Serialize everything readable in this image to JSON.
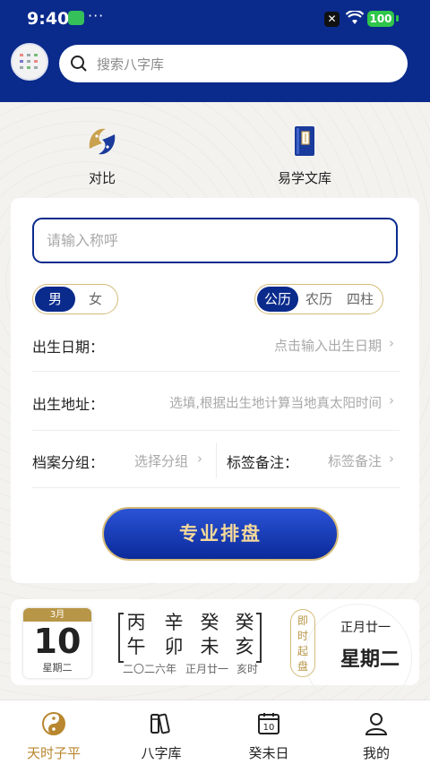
{
  "status": {
    "time": "9:40",
    "dots": "···",
    "battery": "100"
  },
  "header": {
    "search_placeholder": "搜索八字库"
  },
  "features": [
    {
      "label": "对比",
      "icon": "fish-taiji-icon"
    },
    {
      "label": "易学文库",
      "icon": "book-icon"
    }
  ],
  "form": {
    "name_placeholder": "请输入称呼",
    "gender": {
      "options": [
        "男",
        "女"
      ],
      "selected": "男"
    },
    "calendar": {
      "options": [
        "公历",
        "农历",
        "四柱"
      ],
      "selected": "公历"
    },
    "birth_date": {
      "label": "出生日期：",
      "value": "点击输入出生日期"
    },
    "birth_place": {
      "label": "出生地址：",
      "value": "选填,根据出生地计算当地真太阳时间"
    },
    "group": {
      "label": "档案分组：",
      "value": "选择分组"
    },
    "tags": {
      "label": "标签备注：",
      "value": "标签备注"
    },
    "submit_label": "专业排盘"
  },
  "calendar_card": {
    "month": "3月",
    "day": "10",
    "weekday_small": "星期二",
    "ganzhi": [
      {
        "top": "丙",
        "bottom": "午"
      },
      {
        "top": "辛",
        "bottom": "卯"
      },
      {
        "top": "癸",
        "bottom": "未"
      },
      {
        "top": "癸",
        "bottom": "亥"
      }
    ],
    "sub_year": "二〇二六年",
    "sub_lunar": "正月廿一",
    "sub_hour": "亥时",
    "qi_label": [
      "即",
      "时",
      "起",
      "盘"
    ],
    "lunar_date": "正月廿一",
    "weekday_big": "星期二"
  },
  "tabs": [
    {
      "label": "天时子平",
      "icon": "taiji-icon",
      "active": true
    },
    {
      "label": "八字库",
      "icon": "books-icon",
      "active": false
    },
    {
      "label": "癸未日",
      "icon": "calendar-icon",
      "active": false,
      "icon_text": "10"
    },
    {
      "label": "我的",
      "icon": "person-icon",
      "active": false
    }
  ],
  "colors": {
    "brand_blue": "#0a2a8c",
    "gold": "#b89647",
    "active_tab": "#b8872f"
  }
}
